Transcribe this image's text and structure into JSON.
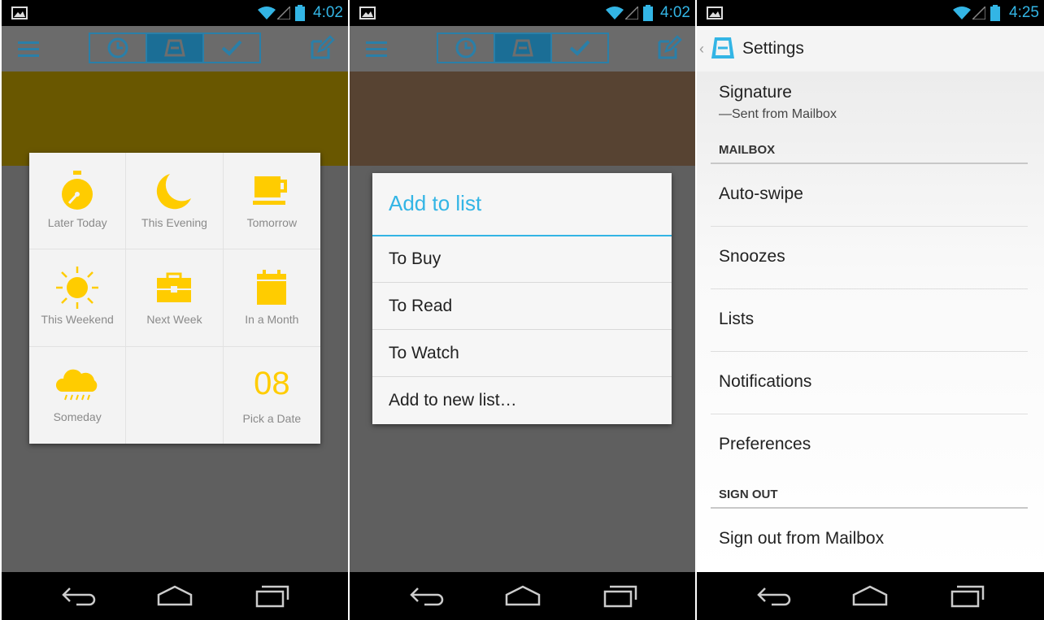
{
  "colors": {
    "accent": "#33b5e5",
    "snooze_yellow": "#ffcc00",
    "panel1_band": "#695700",
    "panel2_band": "#574332"
  },
  "panels": [
    {
      "status": {
        "time": "4:02"
      },
      "toolbar": {
        "tabs": [
          "clock-icon",
          "inbox-icon",
          "check-icon"
        ],
        "active_tab": 1
      },
      "snooze": {
        "options": [
          {
            "icon": "stopwatch-icon",
            "label": "Later Today"
          },
          {
            "icon": "moon-icon",
            "label": "This Evening"
          },
          {
            "icon": "coffee-cup-icon",
            "label": "Tomorrow"
          },
          {
            "icon": "sun-icon",
            "label": "This Weekend"
          },
          {
            "icon": "briefcase-icon",
            "label": "Next Week"
          },
          {
            "icon": "calendar-icon",
            "label": "In a Month"
          },
          {
            "icon": "rain-cloud-icon",
            "label": "Someday"
          },
          {
            "icon": "",
            "label": ""
          },
          {
            "date_number": "08",
            "label": "Pick a Date"
          }
        ]
      }
    },
    {
      "status": {
        "time": "4:02"
      },
      "toolbar": {
        "tabs": [
          "clock-icon",
          "inbox-icon",
          "check-icon"
        ],
        "active_tab": 1
      },
      "dialog": {
        "title": "Add to list",
        "items": [
          "To Buy",
          "To Read",
          "To Watch",
          "Add to new list…"
        ]
      }
    },
    {
      "status": {
        "time": "4:25"
      },
      "settings": {
        "title": "Settings",
        "signature": {
          "title": "Signature",
          "value": "—Sent from Mailbox"
        },
        "section_mailbox": "MAILBOX",
        "items": [
          "Auto-swipe",
          "Snoozes",
          "Lists",
          "Notifications",
          "Preferences"
        ],
        "section_signout": "SIGN OUT",
        "signout_label": "Sign out from Mailbox"
      }
    }
  ]
}
